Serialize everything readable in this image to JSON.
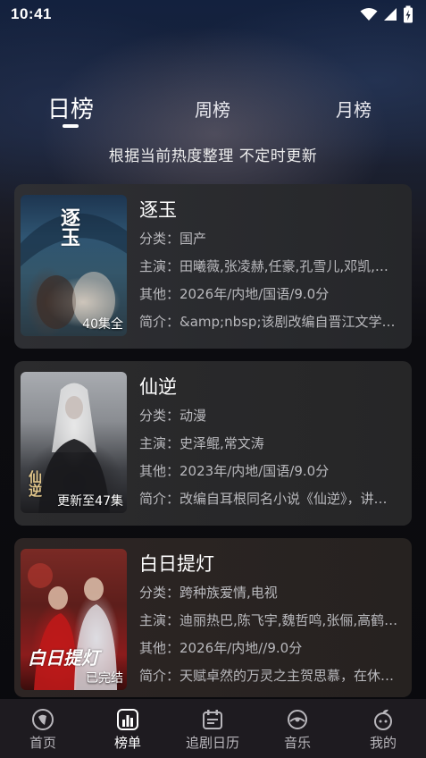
{
  "status_bar": {
    "time": "10:41"
  },
  "tabs": [
    {
      "label": "日榜"
    },
    {
      "label": "周榜"
    },
    {
      "label": "月榜"
    }
  ],
  "subtitle": "根据当前热度整理 不定时更新",
  "shows": [
    {
      "title": "逐玉",
      "poster_text": "逐玉",
      "badge": "40集全",
      "category_label": "分类：",
      "category": "国产",
      "cast_label": "主演：",
      "cast": "田曦薇,张凌赫,任豪,孔雪儿,邓凯,…",
      "other_label": "其他：",
      "other": "2026年/内地/国语/9.0分",
      "intro_label": "简介：",
      "intro": "&amp;nbsp;该剧改编自晋江文学…"
    },
    {
      "title": "仙逆",
      "poster_text": "仙逆",
      "badge": "更新至47集",
      "category_label": "分类：",
      "category": "动漫",
      "cast_label": "主演：",
      "cast": "史泽鲲,常文涛",
      "other_label": "其他：",
      "other": "2023年/内地/国语/9.0分",
      "intro_label": "简介：",
      "intro": "改编自耳根同名小说《仙逆》，讲…"
    },
    {
      "title": "白日提灯",
      "poster_text": "白日提灯",
      "badge": "已完结",
      "category_label": "分类：",
      "category": "跨种族爱情,电视",
      "cast_label": "主演：",
      "cast": "迪丽热巴,陈飞宇,魏哲鸣,张俪,高鹤…",
      "other_label": "其他：",
      "other": "2026年/内地//9.0分",
      "intro_label": "简介：",
      "intro": "天赋卓然的万灵之主贺思慕，在休…"
    }
  ],
  "nav": [
    {
      "label": "首页",
      "icon": "home-icon"
    },
    {
      "label": "榜单",
      "icon": "ranking-icon",
      "active": true
    },
    {
      "label": "追剧日历",
      "icon": "calendar-icon"
    },
    {
      "label": "音乐",
      "icon": "music-icon"
    },
    {
      "label": "我的",
      "icon": "profile-icon"
    }
  ],
  "colors": {
    "active_nav": "#ffffff",
    "inactive_nav": "#b8b6bb",
    "card_bg": "#2b2b2e"
  }
}
